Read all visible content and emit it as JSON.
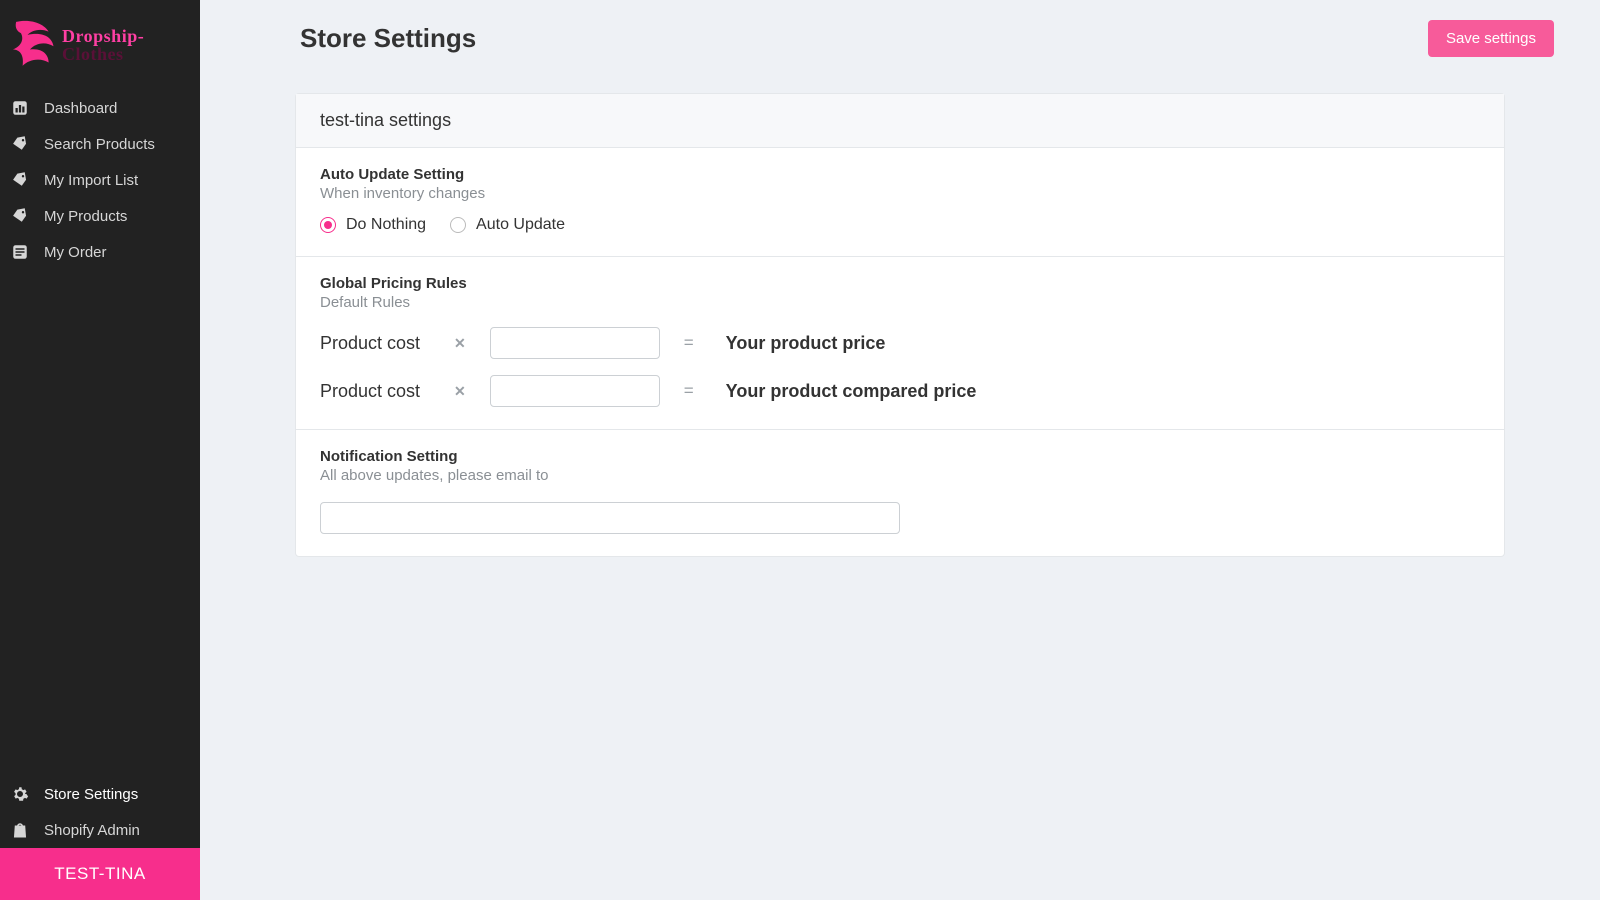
{
  "brand": {
    "name": "Dropship-Clothes"
  },
  "sidebar": {
    "items_top": [
      {
        "label": "Dashboard",
        "icon": "bar-chart-icon"
      },
      {
        "label": "Search Products",
        "icon": "tag-icon"
      },
      {
        "label": "My Import List",
        "icon": "tag-icon"
      },
      {
        "label": "My Products",
        "icon": "tag-icon"
      },
      {
        "label": "My Order",
        "icon": "list-icon"
      }
    ],
    "items_bottom": [
      {
        "label": "Store Settings",
        "icon": "gear-icon",
        "active": true
      },
      {
        "label": "Shopify Admin",
        "icon": "bag-icon"
      }
    ],
    "store_badge": "TEST-TINA"
  },
  "page": {
    "title": "Store Settings",
    "save_label": "Save settings"
  },
  "card": {
    "header": "test-tina settings",
    "auto_update": {
      "title": "Auto Update Setting",
      "subtitle": "When inventory changes",
      "option_do_nothing": "Do Nothing",
      "option_auto_update": "Auto Update",
      "selected": "do_nothing"
    },
    "pricing": {
      "title": "Global Pricing Rules",
      "subtitle": "Default Rules",
      "row1": {
        "label": "Product cost",
        "multiplier": "",
        "result_label": "Your product price"
      },
      "row2": {
        "label": "Product cost",
        "multiplier": "",
        "result_label": "Your product compared price"
      },
      "op_multiply": "✕",
      "op_equals": "="
    },
    "notification": {
      "title": "Notification Setting",
      "subtitle": "All above updates, please email to",
      "email_value": ""
    }
  }
}
